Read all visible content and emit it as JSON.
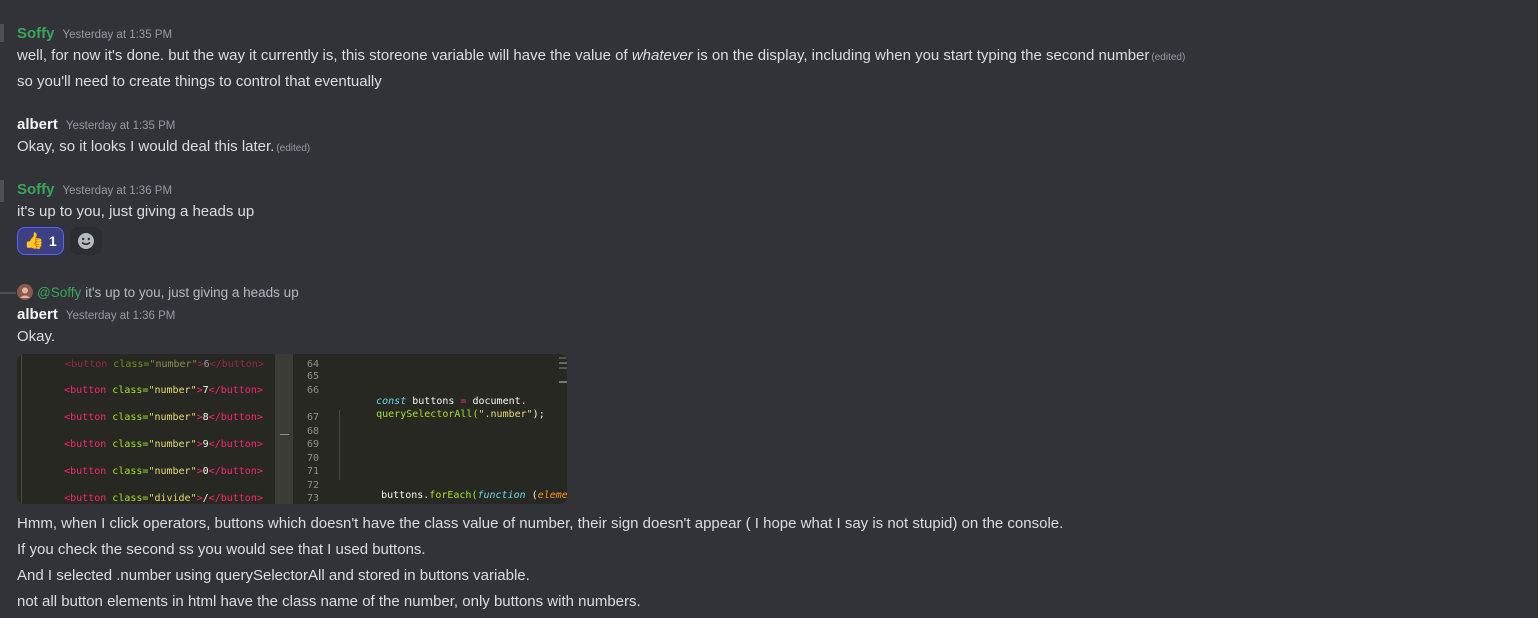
{
  "messages": [
    {
      "author": "Soffy",
      "timestamp": "Yesterday at 1:35 PM",
      "lines": [
        {
          "pre": "well, for now it's done. but the way it currently is, this storeone variable will have the value of ",
          "em": "whatever",
          "post": " is on the display, including when you start typing the second number",
          "edited": "(edited)"
        },
        {
          "text": "so you'll need to create things to control that eventually"
        }
      ]
    },
    {
      "author": "albert",
      "timestamp": "Yesterday at 1:35 PM",
      "lines": [
        {
          "text": "Okay, so it looks I would deal this later.",
          "edited": "(edited)"
        }
      ]
    },
    {
      "author": "Soffy",
      "timestamp": "Yesterday at 1:36 PM",
      "lines": [
        {
          "text": "it's up to you, just giving a heads up"
        }
      ],
      "reaction": {
        "emoji": "👍",
        "count": "1"
      }
    },
    {
      "reply": {
        "mention": "@Soffy",
        "text": "it's up to you, just giving a heads up"
      },
      "author": "albert",
      "timestamp": "Yesterday at 1:36 PM",
      "lines": [
        {
          "text": "Okay."
        }
      ],
      "code_image": {
        "left": [
          {
            "open": "<button",
            "attr": " class=",
            "val": "\"number\"",
            "close": ">",
            "inner": "7",
            "end": "</button>"
          },
          {
            "open": "<button",
            "attr": " class=",
            "val": "\"number\"",
            "close": ">",
            "inner": "8",
            "end": "</button>"
          },
          {
            "open": "<button",
            "attr": " class=",
            "val": "\"number\"",
            "close": ">",
            "inner": "9",
            "end": "</button>"
          },
          {
            "open": "<button",
            "attr": " class=",
            "val": "\"number\"",
            "close": ">",
            "inner": "0",
            "end": "</button>"
          },
          {
            "open": "<button",
            "attr": " class=",
            "val": "\"divide\"",
            "close": ">",
            "inner": "/",
            "end": "</button>"
          }
        ],
        "line_numbers": [
          "64",
          "65",
          "66",
          "67",
          "68",
          "69",
          "70",
          "71",
          "72",
          "73"
        ],
        "right": {
          "line66_kw": "const",
          "line66_var": " buttons ",
          "line66_op": "=",
          "line66_rest": " document.",
          "line66b_fn": "querySelectorAll(",
          "line66b_str": "\".number\"",
          "line66b_end": ");",
          "line72_obj": "buttons.",
          "line72_fn": "forEach(",
          "line72_kw": "function",
          "line72_sp": " (",
          "line72_param": "element",
          "line72_end": ") {"
        }
      },
      "after_lines": [
        "Hmm, when I click operators, buttons which doesn't have the class value of number, their sign doesn't appear ( I hope what I say is not stupid) on the console.",
        "If you check the second ss you would see that I used buttons.",
        "And I selected .number using querySelectorAll and stored in buttons variable.",
        "not all button elements in html have the class name of the number, only buttons with numbers."
      ]
    }
  ]
}
